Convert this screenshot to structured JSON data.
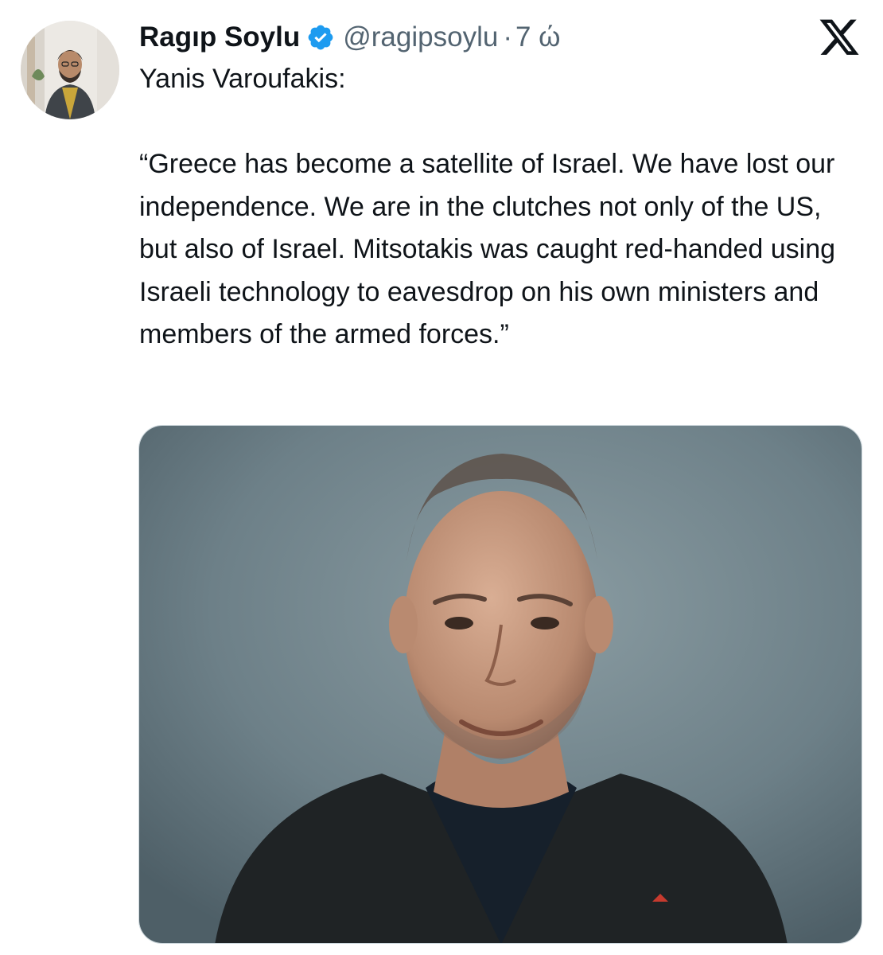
{
  "tweet": {
    "author": {
      "display_name": "Ragıp Soylu",
      "handle": "@ragipsoylu",
      "verified": true,
      "avatar_icon": "avatar-photo"
    },
    "separator": "·",
    "timestamp": "7 ώ",
    "text": "Yanis Varoufakis:\n\n“Greece has become a satellite of Israel. We have lost our independence. We are in the clutches not only of the US, but also of Israel. Mitsotakis was caught red-handed using Israeli technology to eavesdrop on his own ministers and members of the armed forces.”",
    "media": {
      "type": "photo",
      "icon": "portrait-photo"
    }
  },
  "brand": {
    "logo_icon": "x-logo-icon"
  },
  "colors": {
    "primary_text": "#0f1419",
    "secondary_text": "#536471",
    "verified_blue": "#1d9bf0",
    "media_background": "#6a7d85"
  }
}
